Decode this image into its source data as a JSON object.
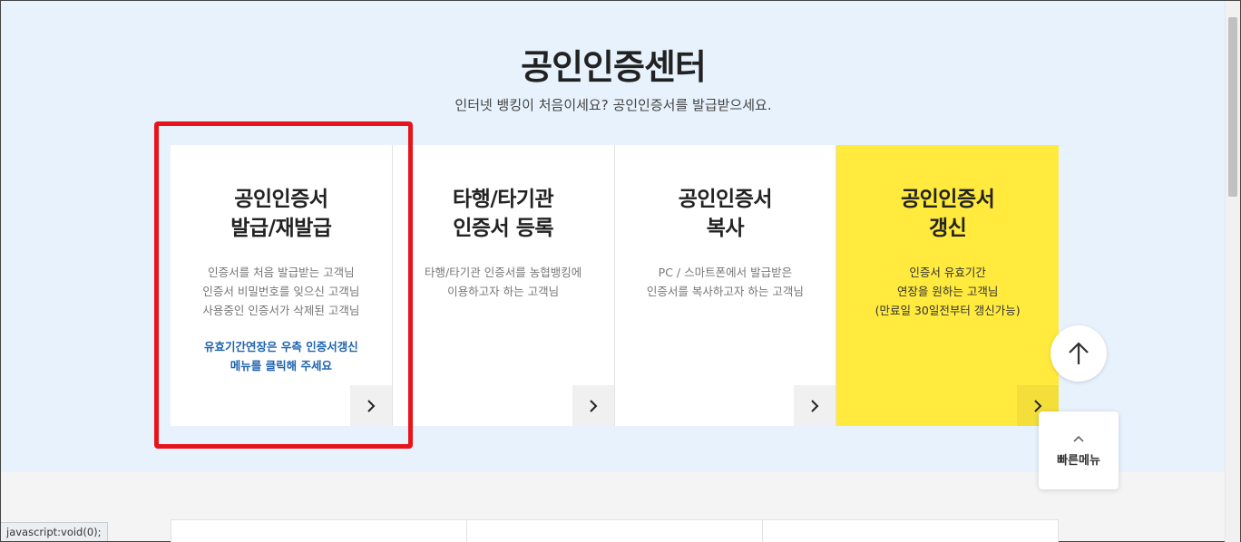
{
  "hero": {
    "title": "공인인증센터",
    "subtitle": "인터넷 뱅킹이 처음이세요? 공인인증서를 발급받으세요."
  },
  "cards": [
    {
      "title": "공인인증서\n발급/재발급",
      "desc": [
        "인증서를 처음 발급받는 고객님",
        "인증서 비밀번호를 잊으신 고객님",
        "사용중인 인증서가 삭제된 고객님"
      ],
      "note": [
        "유효기간연장은 우측 인증서갱신",
        "메뉴를 클릭해 주세요"
      ],
      "arrow_icon": "chevron-right-icon"
    },
    {
      "title": "타행/타기관\n인증서 등록",
      "desc": [
        "타행/타기관 인증서를 농협뱅킹에",
        "이용하고자 하는 고객님"
      ],
      "arrow_icon": "chevron-right-icon"
    },
    {
      "title": "공인인증서\n복사",
      "desc": [
        "PC / 스마트폰에서 발급받은",
        "인증서를 복사하고자 하는 고객님"
      ],
      "arrow_icon": "chevron-right-icon"
    },
    {
      "title": "공인인증서\n갱신",
      "desc": [
        "인증서 유효기간",
        "연장을 원하는 고객님",
        "(만료일 30일전부터 갱신가능)"
      ],
      "arrow_icon": "chevron-right-icon"
    }
  ],
  "quick_menu": {
    "label": "빠른메뉴"
  },
  "status_bar": {
    "text": "javascript:void(0);"
  },
  "colors": {
    "hero_bg": "#e7f2fd",
    "highlight": "#ffea3d",
    "note_blue": "#1f63b0",
    "red_box": "#e8141b"
  }
}
